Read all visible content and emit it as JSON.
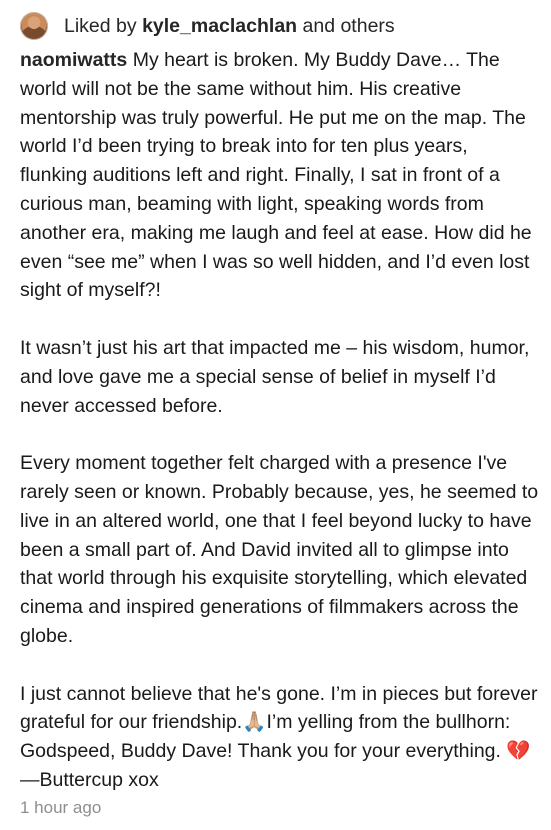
{
  "likes": {
    "avatar_icon": "user-avatar",
    "prefix": "Liked by ",
    "user": "kyle_maclachlan",
    "suffix": " and others"
  },
  "post": {
    "author": "naomiwatts",
    "caption": " My heart is broken. My Buddy Dave… The world will not be the same without him.  His creative mentorship was truly powerful. He put me on the map. The world I’d been trying to break into for ten plus years, flunking auditions left and right. Finally, I sat in front of a curious man, beaming with light, speaking words from another era, making me laugh and feel at ease. How did he even “see me” when I was so well hidden, and I’d even lost sight of myself?!\n\nIt wasn’t just his art that impacted me – his wisdom, humor, and love gave me a special sense of belief in myself I’d never accessed before.\n\nEvery moment together felt charged with a presence I've rarely seen or known. Probably because, yes, he seemed to live in an altered world, one that I feel beyond lucky to have been a small part of. And David invited all to glimpse into that world through his exquisite storytelling, which elevated cinema and inspired generations of filmmakers across the globe.\n\n I just cannot believe that he's gone. I’m in pieces but forever grateful for our friendship.🙏🏼I’m yelling from the bullhorn: Godspeed, Buddy Dave! Thank you for your everything. 💔—Buttercup xox",
    "timestamp": "1 hour ago"
  }
}
